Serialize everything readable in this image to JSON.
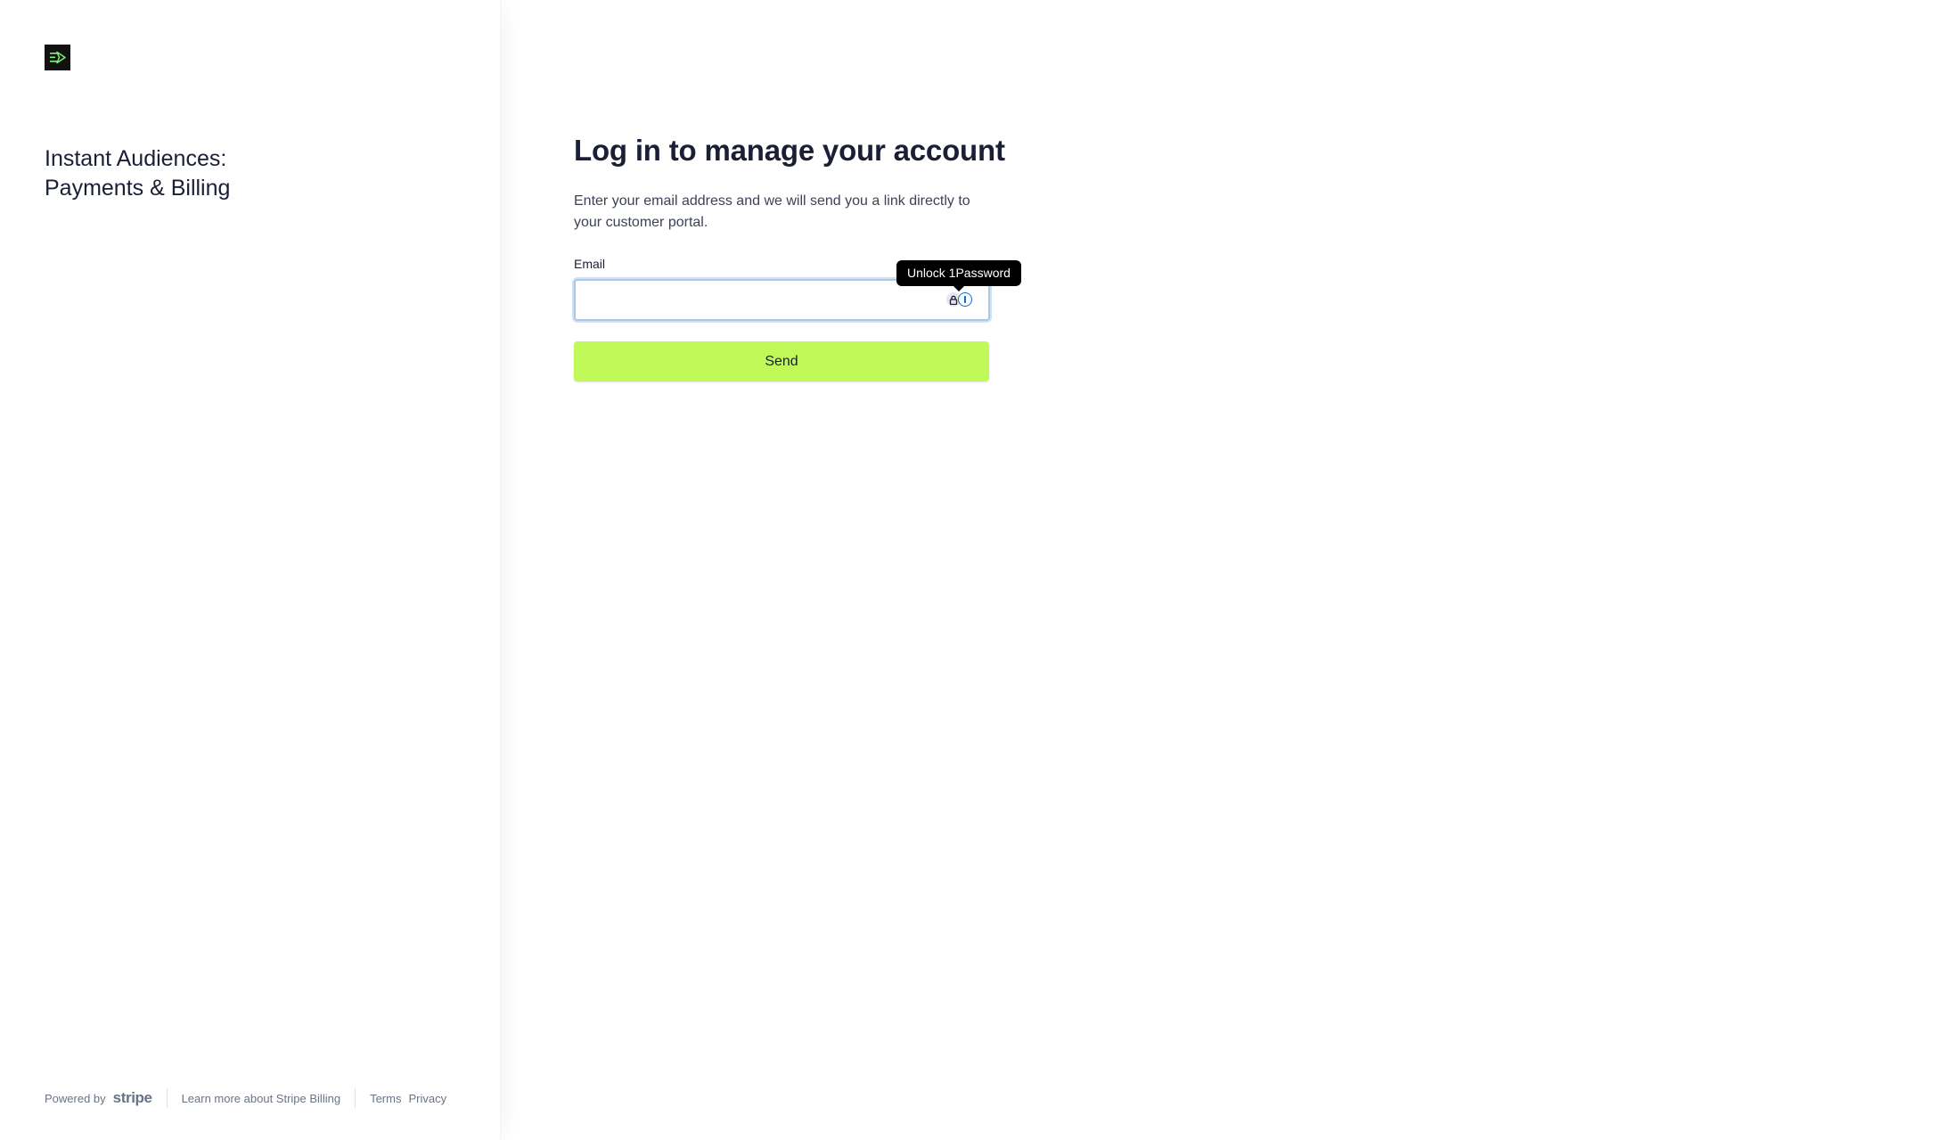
{
  "brand": {
    "logo_icon": "send-arrow-logo-icon",
    "business_name_line1": "Instant Audiences:",
    "business_name_line2": "Payments & Billing"
  },
  "footer": {
    "powered_by": "Powered by",
    "stripe": "stripe",
    "learn_more": "Learn more about Stripe Billing",
    "terms": "Terms",
    "privacy": "Privacy"
  },
  "login": {
    "title": "Log in to manage your account",
    "description_line1": "Enter your email address and we will send you a link directly to",
    "description_line2": "your customer portal.",
    "email_label": "Email",
    "email_value": "",
    "send_label": "Send"
  },
  "password_manager": {
    "tooltip": "Unlock 1Password",
    "icons": [
      "lock-icon",
      "1password-icon"
    ]
  },
  "colors": {
    "accent": "#c0f958",
    "logo_bg": "#111111",
    "logo_glyph": "#7ef27a",
    "text": "#1a1f36",
    "muted": "#697386",
    "focus_ring": "#a9c7e6",
    "onepassword_blue": "#0a6dd8"
  }
}
